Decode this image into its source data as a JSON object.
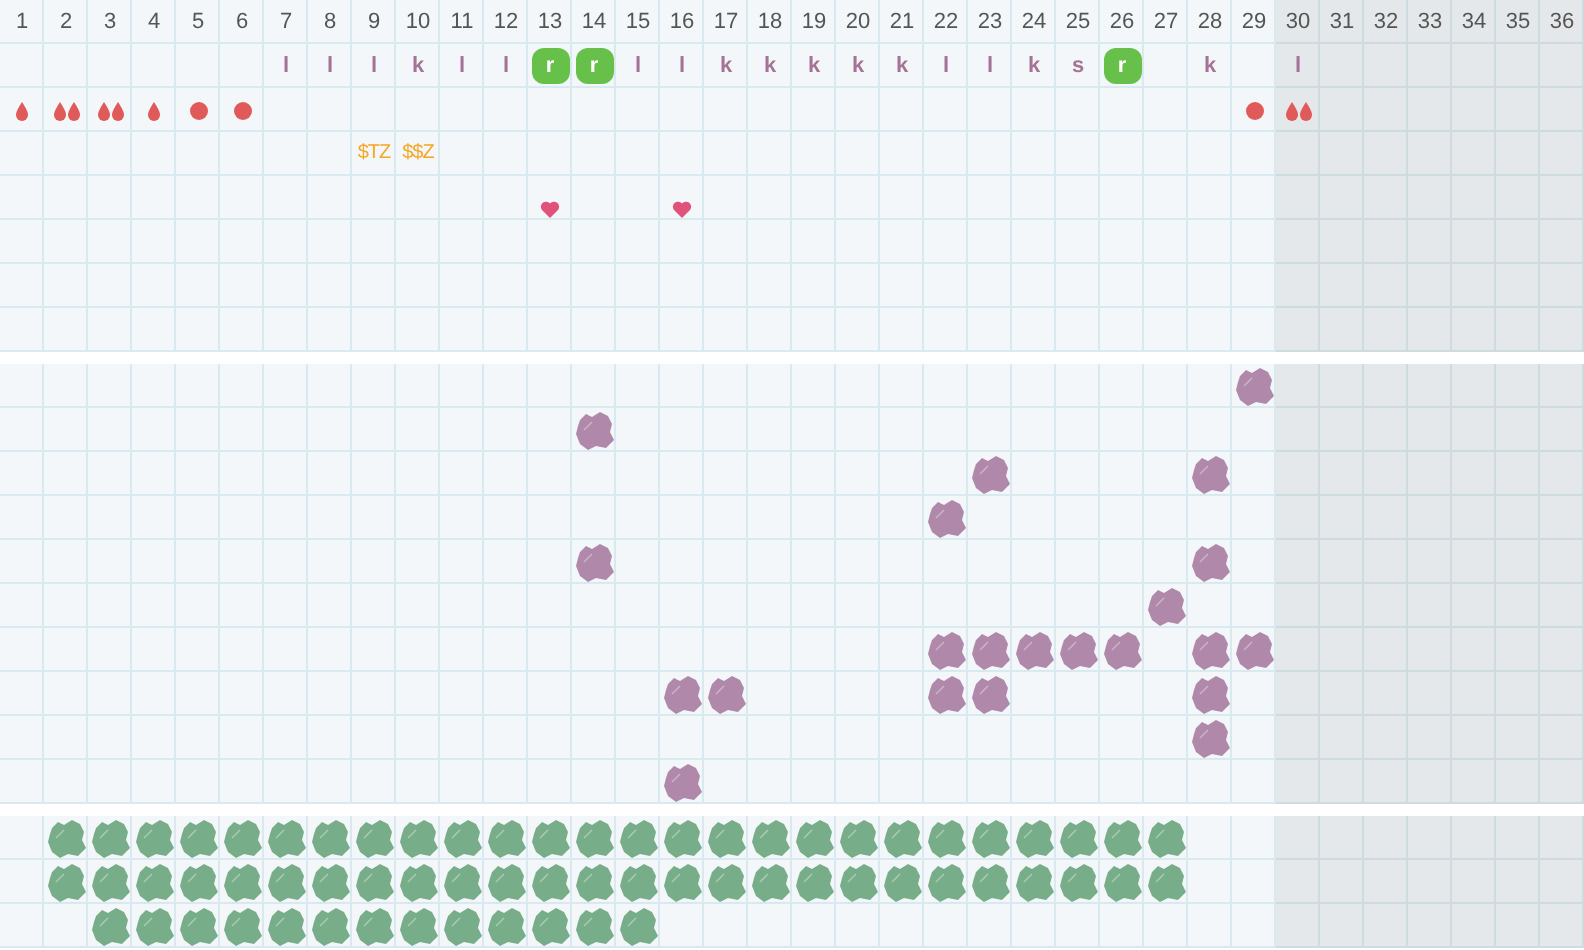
{
  "days": [
    {
      "label": "1",
      "shaded": false
    },
    {
      "label": "2",
      "shaded": false
    },
    {
      "label": "3",
      "shaded": false
    },
    {
      "label": "4",
      "shaded": false
    },
    {
      "label": "5",
      "shaded": false
    },
    {
      "label": "6",
      "shaded": false
    },
    {
      "label": "7",
      "shaded": false
    },
    {
      "label": "8",
      "shaded": false
    },
    {
      "label": "9",
      "shaded": false
    },
    {
      "label": "10",
      "shaded": false
    },
    {
      "label": "11",
      "shaded": false
    },
    {
      "label": "12",
      "shaded": false
    },
    {
      "label": "13",
      "shaded": false
    },
    {
      "label": "14",
      "shaded": false
    },
    {
      "label": "15",
      "shaded": false
    },
    {
      "label": "16",
      "shaded": false
    },
    {
      "label": "17",
      "shaded": false
    },
    {
      "label": "18",
      "shaded": false
    },
    {
      "label": "19",
      "shaded": false
    },
    {
      "label": "20",
      "shaded": false
    },
    {
      "label": "21",
      "shaded": false
    },
    {
      "label": "22",
      "shaded": false
    },
    {
      "label": "23",
      "shaded": false
    },
    {
      "label": "24",
      "shaded": false
    },
    {
      "label": "25",
      "shaded": false
    },
    {
      "label": "26",
      "shaded": false
    },
    {
      "label": "27",
      "shaded": false
    },
    {
      "label": "28",
      "shaded": false
    },
    {
      "label": "29",
      "shaded": false
    },
    {
      "label": "30",
      "shaded": true
    },
    {
      "label": "31",
      "shaded": true
    },
    {
      "label": "32",
      "shaded": true
    },
    {
      "label": "33",
      "shaded": true
    },
    {
      "label": "34",
      "shaded": true
    },
    {
      "label": "35",
      "shaded": true
    },
    {
      "label": "36",
      "shaded": true
    }
  ],
  "top_rows": [
    [
      {
        "kind": "none"
      },
      {
        "kind": "none"
      },
      {
        "kind": "none"
      },
      {
        "kind": "none"
      },
      {
        "kind": "none"
      },
      {
        "kind": "none"
      },
      {
        "kind": "letter",
        "text": "l"
      },
      {
        "kind": "letter",
        "text": "l"
      },
      {
        "kind": "letter",
        "text": "l"
      },
      {
        "kind": "letter",
        "text": "k"
      },
      {
        "kind": "letter",
        "text": "l"
      },
      {
        "kind": "letter",
        "text": "l"
      },
      {
        "kind": "badge",
        "text": "r"
      },
      {
        "kind": "badge",
        "text": "r"
      },
      {
        "kind": "letter",
        "text": "l"
      },
      {
        "kind": "letter",
        "text": "l"
      },
      {
        "kind": "letter",
        "text": "k"
      },
      {
        "kind": "letter",
        "text": "k"
      },
      {
        "kind": "letter",
        "text": "k"
      },
      {
        "kind": "letter",
        "text": "k"
      },
      {
        "kind": "letter",
        "text": "k"
      },
      {
        "kind": "letter",
        "text": "l"
      },
      {
        "kind": "letter",
        "text": "l"
      },
      {
        "kind": "letter",
        "text": "k"
      },
      {
        "kind": "letter",
        "text": "s"
      },
      {
        "kind": "badge",
        "text": "r"
      },
      {
        "kind": "none"
      },
      {
        "kind": "letter",
        "text": "k"
      },
      {
        "kind": "none"
      },
      {
        "kind": "letter",
        "text": "l"
      },
      {
        "kind": "none"
      },
      {
        "kind": "none"
      },
      {
        "kind": "none"
      },
      {
        "kind": "none"
      },
      {
        "kind": "none"
      },
      {
        "kind": "none"
      }
    ],
    [
      {
        "kind": "drop"
      },
      {
        "kind": "drops"
      },
      {
        "kind": "drops"
      },
      {
        "kind": "drop"
      },
      {
        "kind": "dot"
      },
      {
        "kind": "dot"
      },
      {
        "kind": "none"
      },
      {
        "kind": "none"
      },
      {
        "kind": "none"
      },
      {
        "kind": "none"
      },
      {
        "kind": "none"
      },
      {
        "kind": "none"
      },
      {
        "kind": "none"
      },
      {
        "kind": "none"
      },
      {
        "kind": "none"
      },
      {
        "kind": "none"
      },
      {
        "kind": "none"
      },
      {
        "kind": "none"
      },
      {
        "kind": "none"
      },
      {
        "kind": "none"
      },
      {
        "kind": "none"
      },
      {
        "kind": "none"
      },
      {
        "kind": "none"
      },
      {
        "kind": "none"
      },
      {
        "kind": "none"
      },
      {
        "kind": "none"
      },
      {
        "kind": "none"
      },
      {
        "kind": "none"
      },
      {
        "kind": "dot"
      },
      {
        "kind": "drops"
      },
      {
        "kind": "none"
      },
      {
        "kind": "none"
      },
      {
        "kind": "none"
      },
      {
        "kind": "none"
      },
      {
        "kind": "none"
      },
      {
        "kind": "none"
      }
    ],
    [
      {
        "kind": "none"
      },
      {
        "kind": "none"
      },
      {
        "kind": "none"
      },
      {
        "kind": "none"
      },
      {
        "kind": "none"
      },
      {
        "kind": "none"
      },
      {
        "kind": "none"
      },
      {
        "kind": "none"
      },
      {
        "kind": "note",
        "text": "$TZ"
      },
      {
        "kind": "note",
        "text": "$$Z"
      },
      {
        "kind": "none"
      },
      {
        "kind": "none"
      },
      {
        "kind": "none"
      },
      {
        "kind": "none"
      },
      {
        "kind": "none"
      },
      {
        "kind": "none"
      },
      {
        "kind": "none"
      },
      {
        "kind": "none"
      },
      {
        "kind": "none"
      },
      {
        "kind": "none"
      },
      {
        "kind": "none"
      },
      {
        "kind": "none"
      },
      {
        "kind": "none"
      },
      {
        "kind": "none"
      },
      {
        "kind": "none"
      },
      {
        "kind": "none"
      },
      {
        "kind": "none"
      },
      {
        "kind": "none"
      },
      {
        "kind": "none"
      },
      {
        "kind": "none"
      },
      {
        "kind": "none"
      },
      {
        "kind": "none"
      },
      {
        "kind": "none"
      },
      {
        "kind": "none"
      },
      {
        "kind": "none"
      },
      {
        "kind": "none"
      }
    ],
    [
      {
        "kind": "none"
      },
      {
        "kind": "none"
      },
      {
        "kind": "none"
      },
      {
        "kind": "none"
      },
      {
        "kind": "none"
      },
      {
        "kind": "none"
      },
      {
        "kind": "none"
      },
      {
        "kind": "none"
      },
      {
        "kind": "none"
      },
      {
        "kind": "none"
      },
      {
        "kind": "none"
      },
      {
        "kind": "none"
      },
      {
        "kind": "heart"
      },
      {
        "kind": "none"
      },
      {
        "kind": "none"
      },
      {
        "kind": "heart"
      },
      {
        "kind": "none"
      },
      {
        "kind": "none"
      },
      {
        "kind": "none"
      },
      {
        "kind": "none"
      },
      {
        "kind": "none"
      },
      {
        "kind": "none"
      },
      {
        "kind": "none"
      },
      {
        "kind": "none"
      },
      {
        "kind": "none"
      },
      {
        "kind": "none"
      },
      {
        "kind": "none"
      },
      {
        "kind": "none"
      },
      {
        "kind": "none"
      },
      {
        "kind": "none"
      },
      {
        "kind": "none"
      },
      {
        "kind": "none"
      },
      {
        "kind": "none"
      },
      {
        "kind": "none"
      },
      {
        "kind": "none"
      },
      {
        "kind": "none"
      }
    ]
  ],
  "grids": [
    {
      "color": "#b088aa",
      "rows": [
        [
          {
            "kind": "none"
          },
          {
            "kind": "none"
          },
          {
            "kind": "none"
          },
          {
            "kind": "none"
          },
          {
            "kind": "none"
          },
          {
            "kind": "none"
          },
          {
            "kind": "none"
          },
          {
            "kind": "none"
          },
          {
            "kind": "none"
          },
          {
            "kind": "none"
          },
          {
            "kind": "none"
          },
          {
            "kind": "none"
          },
          {
            "kind": "none"
          },
          {
            "kind": "none"
          },
          {
            "kind": "none"
          },
          {
            "kind": "none"
          },
          {
            "kind": "none"
          },
          {
            "kind": "none"
          },
          {
            "kind": "none"
          },
          {
            "kind": "none"
          },
          {
            "kind": "none"
          },
          {
            "kind": "none"
          },
          {
            "kind": "none"
          },
          {
            "kind": "none"
          },
          {
            "kind": "none"
          },
          {
            "kind": "none"
          },
          {
            "kind": "none"
          },
          {
            "kind": "none"
          },
          {
            "kind": "blob"
          },
          {
            "kind": "none"
          },
          {
            "kind": "none"
          },
          {
            "kind": "none"
          },
          {
            "kind": "none"
          },
          {
            "kind": "none"
          },
          {
            "kind": "none"
          },
          {
            "kind": "none"
          }
        ],
        [
          {
            "kind": "none"
          },
          {
            "kind": "none"
          },
          {
            "kind": "none"
          },
          {
            "kind": "none"
          },
          {
            "kind": "none"
          },
          {
            "kind": "none"
          },
          {
            "kind": "none"
          },
          {
            "kind": "none"
          },
          {
            "kind": "none"
          },
          {
            "kind": "none"
          },
          {
            "kind": "none"
          },
          {
            "kind": "none"
          },
          {
            "kind": "none"
          },
          {
            "kind": "blob"
          },
          {
            "kind": "none"
          },
          {
            "kind": "none"
          },
          {
            "kind": "none"
          },
          {
            "kind": "none"
          },
          {
            "kind": "none"
          },
          {
            "kind": "none"
          },
          {
            "kind": "none"
          },
          {
            "kind": "none"
          },
          {
            "kind": "none"
          },
          {
            "kind": "none"
          },
          {
            "kind": "none"
          },
          {
            "kind": "none"
          },
          {
            "kind": "none"
          },
          {
            "kind": "none"
          },
          {
            "kind": "none"
          },
          {
            "kind": "none"
          },
          {
            "kind": "none"
          },
          {
            "kind": "none"
          },
          {
            "kind": "none"
          },
          {
            "kind": "none"
          },
          {
            "kind": "none"
          },
          {
            "kind": "none"
          }
        ],
        [
          {
            "kind": "none"
          },
          {
            "kind": "none"
          },
          {
            "kind": "none"
          },
          {
            "kind": "none"
          },
          {
            "kind": "none"
          },
          {
            "kind": "none"
          },
          {
            "kind": "none"
          },
          {
            "kind": "none"
          },
          {
            "kind": "none"
          },
          {
            "kind": "none"
          },
          {
            "kind": "none"
          },
          {
            "kind": "none"
          },
          {
            "kind": "none"
          },
          {
            "kind": "none"
          },
          {
            "kind": "none"
          },
          {
            "kind": "none"
          },
          {
            "kind": "none"
          },
          {
            "kind": "none"
          },
          {
            "kind": "none"
          },
          {
            "kind": "none"
          },
          {
            "kind": "none"
          },
          {
            "kind": "none"
          },
          {
            "kind": "blob"
          },
          {
            "kind": "none"
          },
          {
            "kind": "none"
          },
          {
            "kind": "none"
          },
          {
            "kind": "none"
          },
          {
            "kind": "blob"
          },
          {
            "kind": "none"
          },
          {
            "kind": "none"
          },
          {
            "kind": "none"
          },
          {
            "kind": "none"
          },
          {
            "kind": "none"
          },
          {
            "kind": "none"
          },
          {
            "kind": "none"
          },
          {
            "kind": "none"
          }
        ],
        [
          {
            "kind": "none"
          },
          {
            "kind": "none"
          },
          {
            "kind": "none"
          },
          {
            "kind": "none"
          },
          {
            "kind": "none"
          },
          {
            "kind": "none"
          },
          {
            "kind": "none"
          },
          {
            "kind": "none"
          },
          {
            "kind": "none"
          },
          {
            "kind": "none"
          },
          {
            "kind": "none"
          },
          {
            "kind": "none"
          },
          {
            "kind": "none"
          },
          {
            "kind": "none"
          },
          {
            "kind": "none"
          },
          {
            "kind": "none"
          },
          {
            "kind": "none"
          },
          {
            "kind": "none"
          },
          {
            "kind": "none"
          },
          {
            "kind": "none"
          },
          {
            "kind": "none"
          },
          {
            "kind": "blob"
          },
          {
            "kind": "none"
          },
          {
            "kind": "none"
          },
          {
            "kind": "none"
          },
          {
            "kind": "none"
          },
          {
            "kind": "none"
          },
          {
            "kind": "none"
          },
          {
            "kind": "none"
          },
          {
            "kind": "none"
          },
          {
            "kind": "none"
          },
          {
            "kind": "none"
          },
          {
            "kind": "none"
          },
          {
            "kind": "none"
          },
          {
            "kind": "none"
          },
          {
            "kind": "none"
          }
        ],
        [
          {
            "kind": "none"
          },
          {
            "kind": "none"
          },
          {
            "kind": "none"
          },
          {
            "kind": "none"
          },
          {
            "kind": "none"
          },
          {
            "kind": "none"
          },
          {
            "kind": "none"
          },
          {
            "kind": "none"
          },
          {
            "kind": "none"
          },
          {
            "kind": "none"
          },
          {
            "kind": "none"
          },
          {
            "kind": "none"
          },
          {
            "kind": "none"
          },
          {
            "kind": "blob"
          },
          {
            "kind": "none"
          },
          {
            "kind": "none"
          },
          {
            "kind": "none"
          },
          {
            "kind": "none"
          },
          {
            "kind": "none"
          },
          {
            "kind": "none"
          },
          {
            "kind": "none"
          },
          {
            "kind": "none"
          },
          {
            "kind": "none"
          },
          {
            "kind": "none"
          },
          {
            "kind": "none"
          },
          {
            "kind": "none"
          },
          {
            "kind": "none"
          },
          {
            "kind": "blob"
          },
          {
            "kind": "none"
          },
          {
            "kind": "none"
          },
          {
            "kind": "none"
          },
          {
            "kind": "none"
          },
          {
            "kind": "none"
          },
          {
            "kind": "none"
          },
          {
            "kind": "none"
          },
          {
            "kind": "none"
          }
        ],
        [
          {
            "kind": "none"
          },
          {
            "kind": "none"
          },
          {
            "kind": "none"
          },
          {
            "kind": "none"
          },
          {
            "kind": "none"
          },
          {
            "kind": "none"
          },
          {
            "kind": "none"
          },
          {
            "kind": "none"
          },
          {
            "kind": "none"
          },
          {
            "kind": "none"
          },
          {
            "kind": "none"
          },
          {
            "kind": "none"
          },
          {
            "kind": "none"
          },
          {
            "kind": "none"
          },
          {
            "kind": "none"
          },
          {
            "kind": "none"
          },
          {
            "kind": "none"
          },
          {
            "kind": "none"
          },
          {
            "kind": "none"
          },
          {
            "kind": "none"
          },
          {
            "kind": "none"
          },
          {
            "kind": "none"
          },
          {
            "kind": "none"
          },
          {
            "kind": "none"
          },
          {
            "kind": "none"
          },
          {
            "kind": "none"
          },
          {
            "kind": "blob"
          },
          {
            "kind": "none"
          },
          {
            "kind": "none"
          },
          {
            "kind": "none"
          },
          {
            "kind": "none"
          },
          {
            "kind": "none"
          },
          {
            "kind": "none"
          },
          {
            "kind": "none"
          },
          {
            "kind": "none"
          },
          {
            "kind": "none"
          }
        ],
        [
          {
            "kind": "none"
          },
          {
            "kind": "none"
          },
          {
            "kind": "none"
          },
          {
            "kind": "none"
          },
          {
            "kind": "none"
          },
          {
            "kind": "none"
          },
          {
            "kind": "none"
          },
          {
            "kind": "none"
          },
          {
            "kind": "none"
          },
          {
            "kind": "none"
          },
          {
            "kind": "none"
          },
          {
            "kind": "none"
          },
          {
            "kind": "none"
          },
          {
            "kind": "none"
          },
          {
            "kind": "none"
          },
          {
            "kind": "none"
          },
          {
            "kind": "none"
          },
          {
            "kind": "none"
          },
          {
            "kind": "none"
          },
          {
            "kind": "none"
          },
          {
            "kind": "none"
          },
          {
            "kind": "blob"
          },
          {
            "kind": "blob"
          },
          {
            "kind": "blob"
          },
          {
            "kind": "blob"
          },
          {
            "kind": "blob"
          },
          {
            "kind": "none"
          },
          {
            "kind": "blob"
          },
          {
            "kind": "blob"
          },
          {
            "kind": "none"
          },
          {
            "kind": "none"
          },
          {
            "kind": "none"
          },
          {
            "kind": "none"
          },
          {
            "kind": "none"
          },
          {
            "kind": "none"
          },
          {
            "kind": "none"
          }
        ],
        [
          {
            "kind": "none"
          },
          {
            "kind": "none"
          },
          {
            "kind": "none"
          },
          {
            "kind": "none"
          },
          {
            "kind": "none"
          },
          {
            "kind": "none"
          },
          {
            "kind": "none"
          },
          {
            "kind": "none"
          },
          {
            "kind": "none"
          },
          {
            "kind": "none"
          },
          {
            "kind": "none"
          },
          {
            "kind": "none"
          },
          {
            "kind": "none"
          },
          {
            "kind": "none"
          },
          {
            "kind": "none"
          },
          {
            "kind": "blob"
          },
          {
            "kind": "blob"
          },
          {
            "kind": "none"
          },
          {
            "kind": "none"
          },
          {
            "kind": "none"
          },
          {
            "kind": "none"
          },
          {
            "kind": "blob"
          },
          {
            "kind": "blob"
          },
          {
            "kind": "none"
          },
          {
            "kind": "none"
          },
          {
            "kind": "none"
          },
          {
            "kind": "none"
          },
          {
            "kind": "blob"
          },
          {
            "kind": "none"
          },
          {
            "kind": "none"
          },
          {
            "kind": "none"
          },
          {
            "kind": "none"
          },
          {
            "kind": "none"
          },
          {
            "kind": "none"
          },
          {
            "kind": "none"
          },
          {
            "kind": "none"
          }
        ],
        [
          {
            "kind": "none"
          },
          {
            "kind": "none"
          },
          {
            "kind": "none"
          },
          {
            "kind": "none"
          },
          {
            "kind": "none"
          },
          {
            "kind": "none"
          },
          {
            "kind": "none"
          },
          {
            "kind": "none"
          },
          {
            "kind": "none"
          },
          {
            "kind": "none"
          },
          {
            "kind": "none"
          },
          {
            "kind": "none"
          },
          {
            "kind": "none"
          },
          {
            "kind": "none"
          },
          {
            "kind": "none"
          },
          {
            "kind": "none"
          },
          {
            "kind": "none"
          },
          {
            "kind": "none"
          },
          {
            "kind": "none"
          },
          {
            "kind": "none"
          },
          {
            "kind": "none"
          },
          {
            "kind": "none"
          },
          {
            "kind": "none"
          },
          {
            "kind": "none"
          },
          {
            "kind": "none"
          },
          {
            "kind": "none"
          },
          {
            "kind": "none"
          },
          {
            "kind": "blob"
          },
          {
            "kind": "none"
          },
          {
            "kind": "none"
          },
          {
            "kind": "none"
          },
          {
            "kind": "none"
          },
          {
            "kind": "none"
          },
          {
            "kind": "none"
          },
          {
            "kind": "none"
          },
          {
            "kind": "none"
          }
        ],
        [
          {
            "kind": "none"
          },
          {
            "kind": "none"
          },
          {
            "kind": "none"
          },
          {
            "kind": "none"
          },
          {
            "kind": "none"
          },
          {
            "kind": "none"
          },
          {
            "kind": "none"
          },
          {
            "kind": "none"
          },
          {
            "kind": "none"
          },
          {
            "kind": "none"
          },
          {
            "kind": "none"
          },
          {
            "kind": "none"
          },
          {
            "kind": "none"
          },
          {
            "kind": "none"
          },
          {
            "kind": "none"
          },
          {
            "kind": "blob"
          },
          {
            "kind": "none"
          },
          {
            "kind": "none"
          },
          {
            "kind": "none"
          },
          {
            "kind": "none"
          },
          {
            "kind": "none"
          },
          {
            "kind": "none"
          },
          {
            "kind": "none"
          },
          {
            "kind": "none"
          },
          {
            "kind": "none"
          },
          {
            "kind": "none"
          },
          {
            "kind": "none"
          },
          {
            "kind": "none"
          },
          {
            "kind": "none"
          },
          {
            "kind": "none"
          },
          {
            "kind": "none"
          },
          {
            "kind": "none"
          },
          {
            "kind": "none"
          },
          {
            "kind": "none"
          },
          {
            "kind": "none"
          },
          {
            "kind": "none"
          }
        ]
      ]
    },
    {
      "color": "#78ad8a",
      "rows": [
        [
          {
            "kind": "none"
          },
          {
            "kind": "blob"
          },
          {
            "kind": "blob"
          },
          {
            "kind": "blob"
          },
          {
            "kind": "blob"
          },
          {
            "kind": "blob"
          },
          {
            "kind": "blob"
          },
          {
            "kind": "blob"
          },
          {
            "kind": "blob"
          },
          {
            "kind": "blob"
          },
          {
            "kind": "blob"
          },
          {
            "kind": "blob"
          },
          {
            "kind": "blob"
          },
          {
            "kind": "blob"
          },
          {
            "kind": "blob"
          },
          {
            "kind": "blob"
          },
          {
            "kind": "blob"
          },
          {
            "kind": "blob"
          },
          {
            "kind": "blob"
          },
          {
            "kind": "blob"
          },
          {
            "kind": "blob"
          },
          {
            "kind": "blob"
          },
          {
            "kind": "blob"
          },
          {
            "kind": "blob"
          },
          {
            "kind": "blob"
          },
          {
            "kind": "blob"
          },
          {
            "kind": "blob"
          },
          {
            "kind": "none"
          },
          {
            "kind": "none"
          },
          {
            "kind": "none"
          },
          {
            "kind": "none"
          },
          {
            "kind": "none"
          },
          {
            "kind": "none"
          },
          {
            "kind": "none"
          },
          {
            "kind": "none"
          },
          {
            "kind": "none"
          }
        ],
        [
          {
            "kind": "none"
          },
          {
            "kind": "blob"
          },
          {
            "kind": "blob"
          },
          {
            "kind": "blob"
          },
          {
            "kind": "blob"
          },
          {
            "kind": "blob"
          },
          {
            "kind": "blob"
          },
          {
            "kind": "blob"
          },
          {
            "kind": "blob"
          },
          {
            "kind": "blob"
          },
          {
            "kind": "blob"
          },
          {
            "kind": "blob"
          },
          {
            "kind": "blob"
          },
          {
            "kind": "blob"
          },
          {
            "kind": "blob"
          },
          {
            "kind": "blob"
          },
          {
            "kind": "blob"
          },
          {
            "kind": "blob"
          },
          {
            "kind": "blob"
          },
          {
            "kind": "blob"
          },
          {
            "kind": "blob"
          },
          {
            "kind": "blob"
          },
          {
            "kind": "blob"
          },
          {
            "kind": "blob"
          },
          {
            "kind": "blob"
          },
          {
            "kind": "blob"
          },
          {
            "kind": "blob"
          },
          {
            "kind": "none"
          },
          {
            "kind": "none"
          },
          {
            "kind": "none"
          },
          {
            "kind": "none"
          },
          {
            "kind": "none"
          },
          {
            "kind": "none"
          },
          {
            "kind": "none"
          },
          {
            "kind": "none"
          },
          {
            "kind": "none"
          }
        ],
        [
          {
            "kind": "none"
          },
          {
            "kind": "none"
          },
          {
            "kind": "blob"
          },
          {
            "kind": "blob"
          },
          {
            "kind": "blob"
          },
          {
            "kind": "blob"
          },
          {
            "kind": "blob"
          },
          {
            "kind": "blob"
          },
          {
            "kind": "blob"
          },
          {
            "kind": "blob"
          },
          {
            "kind": "blob"
          },
          {
            "kind": "blob"
          },
          {
            "kind": "blob"
          },
          {
            "kind": "blob"
          },
          {
            "kind": "blob"
          },
          {
            "kind": "none"
          },
          {
            "kind": "none"
          },
          {
            "kind": "none"
          },
          {
            "kind": "none"
          },
          {
            "kind": "none"
          },
          {
            "kind": "none"
          },
          {
            "kind": "none"
          },
          {
            "kind": "none"
          },
          {
            "kind": "none"
          },
          {
            "kind": "none"
          },
          {
            "kind": "none"
          },
          {
            "kind": "none"
          },
          {
            "kind": "none"
          },
          {
            "kind": "none"
          },
          {
            "kind": "none"
          },
          {
            "kind": "none"
          },
          {
            "kind": "none"
          },
          {
            "kind": "none"
          },
          {
            "kind": "none"
          },
          {
            "kind": "none"
          },
          {
            "kind": "none"
          }
        ]
      ]
    }
  ]
}
